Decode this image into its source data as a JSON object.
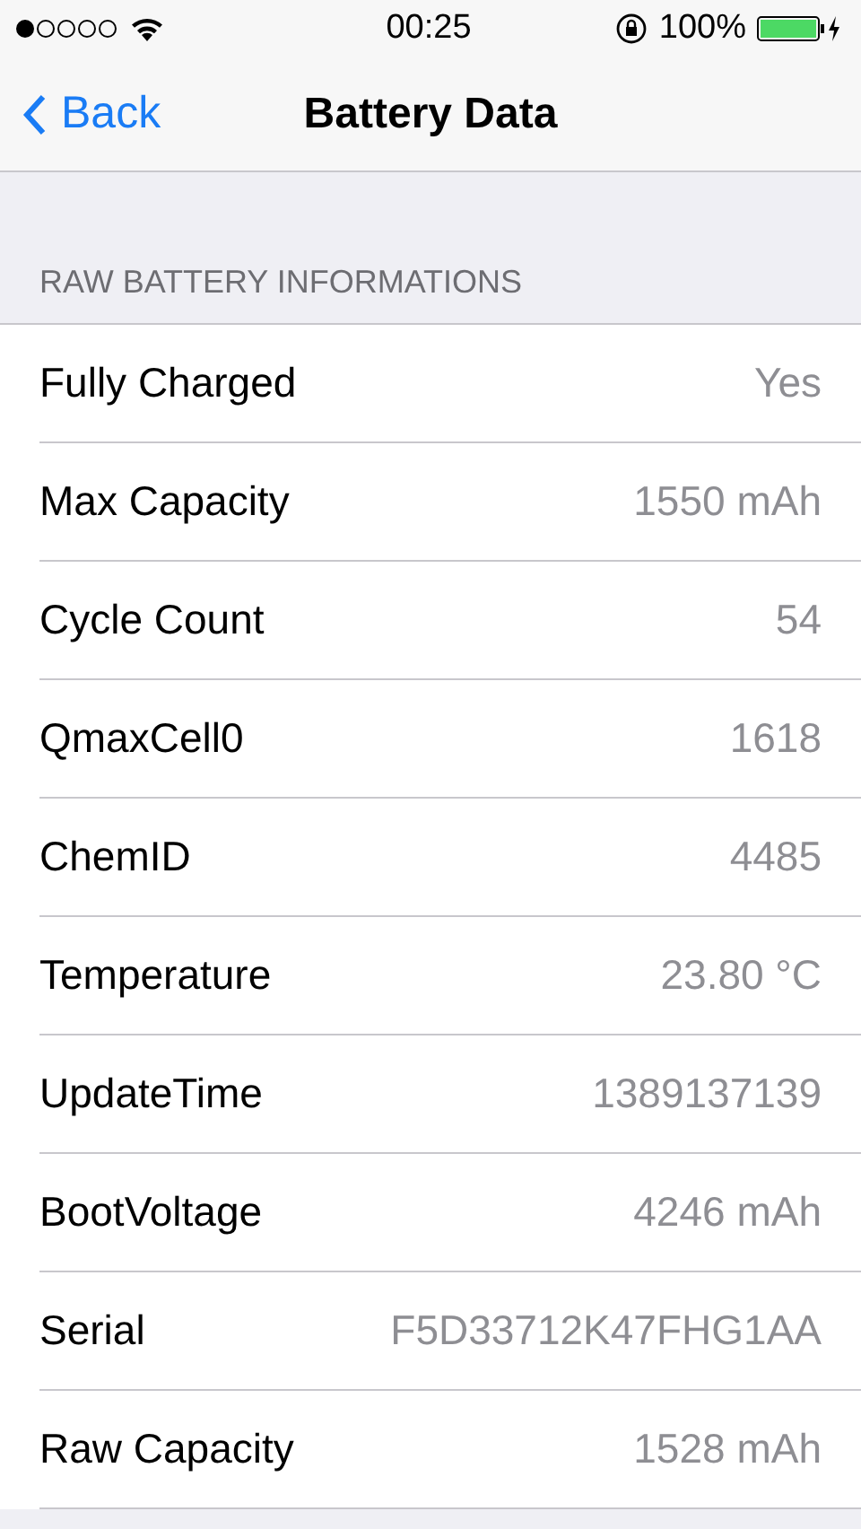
{
  "status_bar": {
    "time": "00:25",
    "battery_percent": "100%"
  },
  "nav": {
    "back": "Back",
    "title": "Battery Data"
  },
  "section": {
    "header": "RAW BATTERY INFORMATIONS",
    "rows": [
      {
        "label": "Fully Charged",
        "value": "Yes"
      },
      {
        "label": "Max Capacity",
        "value": "1550 mAh"
      },
      {
        "label": "Cycle Count",
        "value": "54"
      },
      {
        "label": "QmaxCell0",
        "value": "1618"
      },
      {
        "label": "ChemID",
        "value": "4485"
      },
      {
        "label": "Temperature",
        "value": "23.80 °C"
      },
      {
        "label": "UpdateTime",
        "value": "1389137139"
      },
      {
        "label": "BootVoltage",
        "value": "4246 mAh"
      },
      {
        "label": "Serial",
        "value": "F5D33712K47FHG1AA"
      },
      {
        "label": "Raw Capacity",
        "value": "1528 mAh"
      }
    ]
  }
}
